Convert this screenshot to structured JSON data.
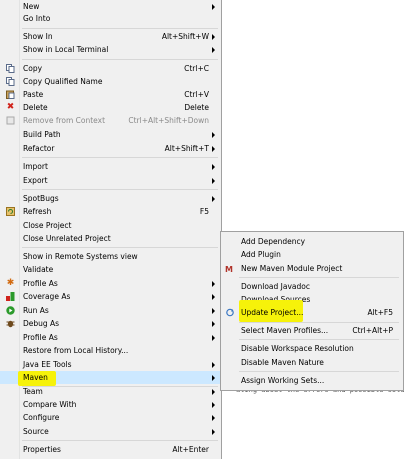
{
  "editor": {
    "background_text": "ating about the errors and possible solutio"
  },
  "menu": {
    "items": {
      "new": {
        "label": "New"
      },
      "go_into": {
        "label": "Go Into"
      },
      "show_in": {
        "label": "Show In",
        "shortcut": "Alt+Shift+W"
      },
      "show_local_terminal": {
        "label": "Show in Local Terminal"
      },
      "copy": {
        "label": "Copy",
        "shortcut": "Ctrl+C"
      },
      "copy_qualified": {
        "label": "Copy Qualified Name"
      },
      "paste": {
        "label": "Paste",
        "shortcut": "Ctrl+V"
      },
      "delete": {
        "label": "Delete",
        "shortcut": "Delete"
      },
      "remove_context": {
        "label": "Remove from Context",
        "shortcut": "Ctrl+Alt+Shift+Down"
      },
      "build_path": {
        "label": "Build Path"
      },
      "refactor": {
        "label": "Refactor",
        "shortcut": "Alt+Shift+T"
      },
      "import": {
        "label": "Import"
      },
      "export": {
        "label": "Export"
      },
      "spotbugs": {
        "label": "SpotBugs"
      },
      "refresh": {
        "label": "Refresh",
        "shortcut": "F5"
      },
      "close_project": {
        "label": "Close Project"
      },
      "close_unrelated": {
        "label": "Close Unrelated Project"
      },
      "show_remote": {
        "label": "Show in Remote Systems view"
      },
      "validate": {
        "label": "Validate"
      },
      "profile_as": {
        "label": "Profile As"
      },
      "coverage_as": {
        "label": "Coverage As"
      },
      "run_as": {
        "label": "Run As"
      },
      "debug_as": {
        "label": "Debug As"
      },
      "profile": {
        "label": "Profile As"
      },
      "restore_history": {
        "label": "Restore from Local History..."
      },
      "java_ee_tools": {
        "label": "Java EE Tools"
      },
      "maven": {
        "label": "Maven"
      },
      "team": {
        "label": "Team"
      },
      "compare_with": {
        "label": "Compare With"
      },
      "configure": {
        "label": "Configure"
      },
      "source": {
        "label": "Source"
      },
      "properties": {
        "label": "Properties",
        "shortcut": "Alt+Enter"
      }
    }
  },
  "submenu": {
    "items": {
      "add_dependency": {
        "label": "Add Dependency"
      },
      "add_plugin": {
        "label": "Add Plugin"
      },
      "new_module": {
        "label": "New Maven Module Project"
      },
      "download_javadoc": {
        "label": "Download Javadoc"
      },
      "download_sources": {
        "label": "Download Sources"
      },
      "update_project": {
        "label": "Update Project...",
        "shortcut": "Alt+F5"
      },
      "select_profiles": {
        "label": "Select Maven Profiles...",
        "shortcut": "Ctrl+Alt+P"
      },
      "disable_resolution": {
        "label": "Disable Workspace Resolution"
      },
      "disable_nature": {
        "label": "Disable Maven Nature"
      },
      "assign_sets": {
        "label": "Assign Working Sets..."
      }
    }
  },
  "colors": {
    "highlight_yellow": "#f6f20a",
    "menu_bg": "#f0f0f0"
  }
}
